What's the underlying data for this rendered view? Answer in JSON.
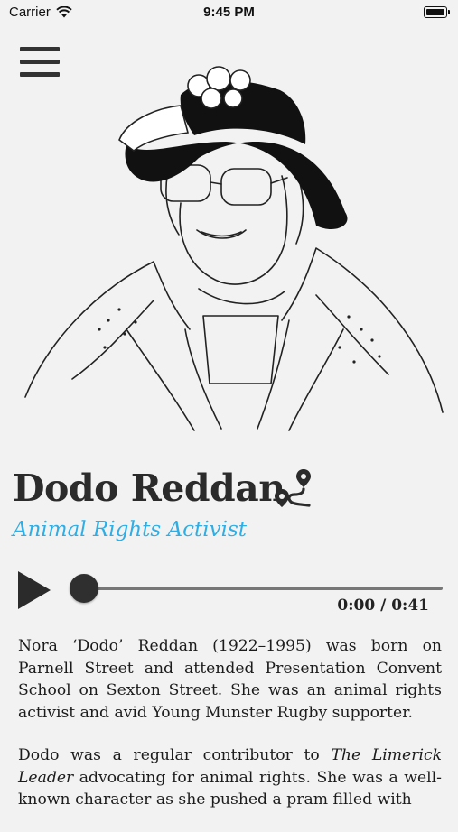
{
  "status_bar": {
    "carrier": "Carrier",
    "time": "9:45 PM",
    "wifi_icon": "wifi-icon",
    "battery_icon": "battery-icon"
  },
  "menu": {
    "icon": "hamburger-menu-icon"
  },
  "portrait": {
    "icon": "portrait-illustration"
  },
  "person": {
    "name": "Dodo Reddan",
    "role": "Animal Rights Activist",
    "map_icon": "map-route-icon"
  },
  "player": {
    "play_icon": "play-icon",
    "time": "0:00 / 0:41",
    "progress": 0
  },
  "bio": {
    "p1": "Nora ‘Dodo’ Reddan (1922–1995) was born on Parnell Street and attended Presentation Convent School on Sexton Street. She was an animal rights activist and avid Young Munster Rugby supporter.",
    "p2_before": "Dodo was a regular contributor to ",
    "p2_italic": "The Limerick Leader",
    "p2_after": " advocating for animal rights. She was a well-known character as she pushed a pram filled with"
  },
  "colors": {
    "background": "#f2f2f2",
    "accent": "#2eaee6",
    "text": "#1c1c1c",
    "track": "#777777",
    "thumb": "#2f2f2f"
  }
}
